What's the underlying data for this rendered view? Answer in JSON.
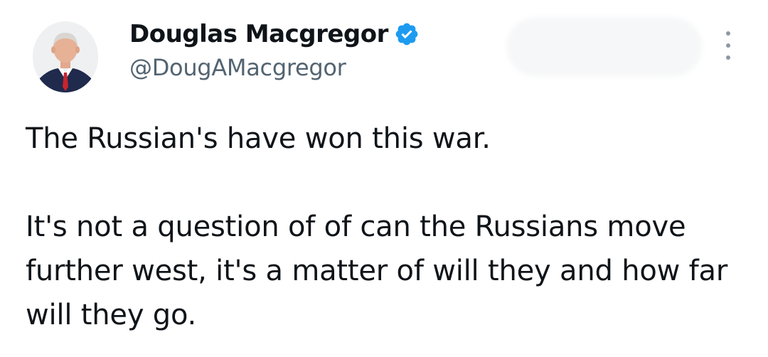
{
  "author": {
    "display_name": "Douglas Macgregor",
    "handle": "@DougAMacgregor",
    "verified": true,
    "verified_badge_color": "#1d9bf0",
    "avatar_icon": "profile-photo"
  },
  "header": {
    "more_icon": "more-vertical-icon"
  },
  "tweet": {
    "paragraphs": [
      "The Russian's have won this war.",
      "It's not a question of of can the Russians move further west, it's a matter of will they and how far will they go."
    ]
  },
  "colors": {
    "text_primary": "#0f1419",
    "text_secondary": "#536471",
    "background": "#ffffff"
  }
}
